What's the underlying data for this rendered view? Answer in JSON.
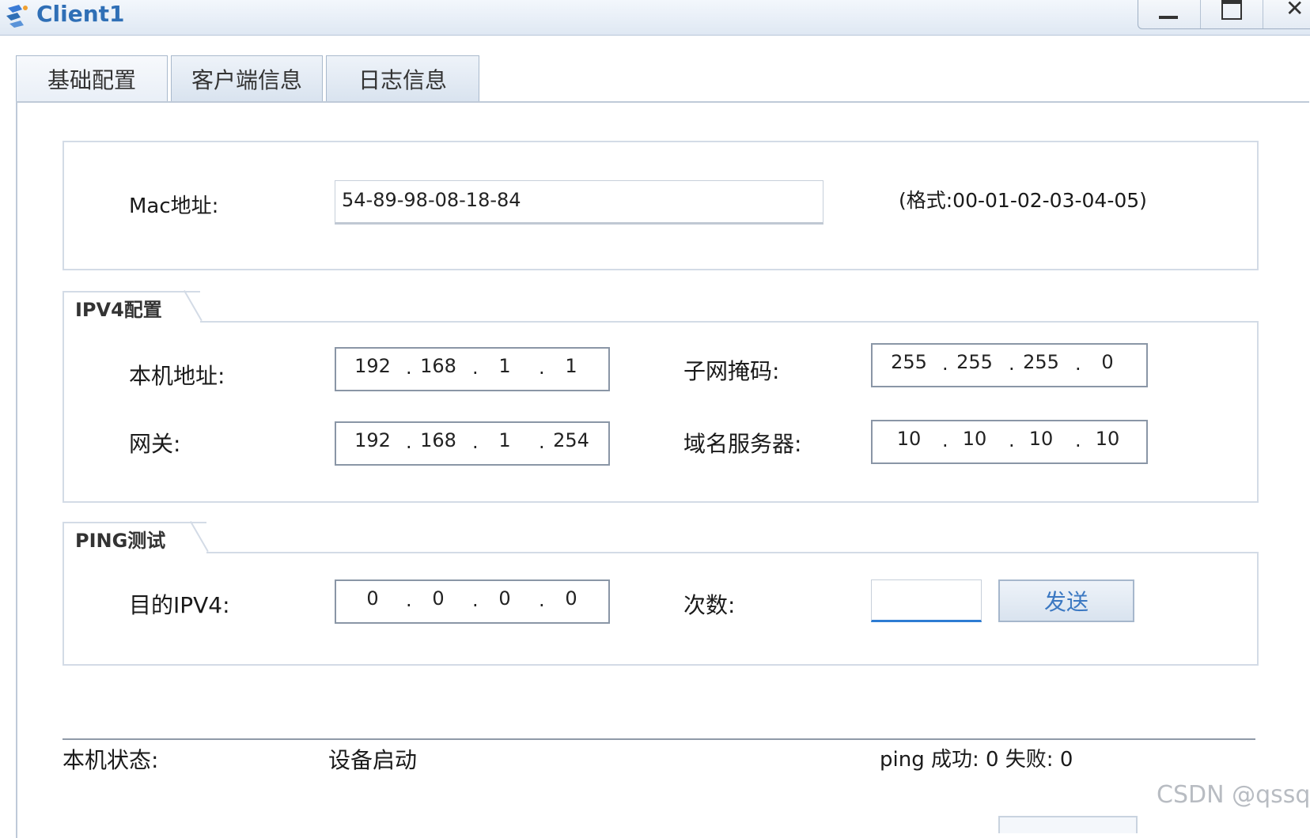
{
  "window": {
    "title": "Client1",
    "app_icon": "network-client-icon"
  },
  "tabs": [
    {
      "label": "基础配置",
      "active": true
    },
    {
      "label": "客户端信息",
      "active": false
    },
    {
      "label": "日志信息",
      "active": false
    }
  ],
  "mac": {
    "label": "Mac地址:",
    "value": "54-89-98-08-18-84",
    "format_hint": "(格式:00-01-02-03-04-05)"
  },
  "ipv4": {
    "group_title": "IPV4配置",
    "local_ip_label": "本机地址:",
    "local_ip": [
      "192",
      "168",
      "1",
      "1"
    ],
    "subnet_label": "子网掩码:",
    "subnet": [
      "255",
      "255",
      "255",
      "0"
    ],
    "gateway_label": "网关:",
    "gateway": [
      "192",
      "168",
      "1",
      "254"
    ],
    "dns_label": "域名服务器:",
    "dns": [
      "10",
      "10",
      "10",
      "10"
    ]
  },
  "ping": {
    "group_title": "PING测试",
    "dest_label": "目的IPV4:",
    "dest": [
      "0",
      "0",
      "0",
      "0"
    ],
    "count_label": "次数:",
    "count_value": "",
    "send_label": "发送"
  },
  "status": {
    "label": "本机状态:",
    "value": "设备启动",
    "ping_result": "ping 成功: 0 失败: 0"
  },
  "watermark": "CSDN @qssq"
}
